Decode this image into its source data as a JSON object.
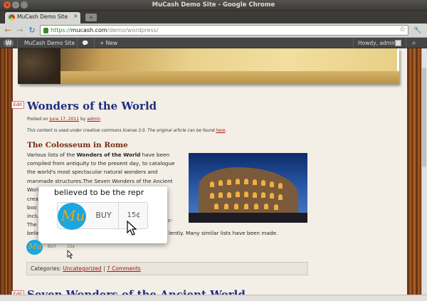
{
  "window": {
    "title": "MuCash Demo Site - Google Chrome",
    "close": "×",
    "minimize": "–",
    "maximize": "□"
  },
  "tab": {
    "label": "MuCash Demo Site",
    "close": "×",
    "new_tab": "+"
  },
  "toolbar": {
    "back": "←",
    "forward": "→",
    "reload": "↻",
    "url_scheme": "https://",
    "url_host": "mucash.com",
    "url_path": "/demo/wordpress/",
    "star": "☆",
    "wrench": "🔧"
  },
  "adminbar": {
    "wp_logo": "W",
    "site_name": "MuCash Demo Site",
    "comments_icon": "💬",
    "new_label": "+ New",
    "greeting": "Howdy, admin",
    "search_icon": "⌕"
  },
  "post": {
    "edit_label": "Edit",
    "title": "Wonders of the World",
    "meta_prefix": "Posted on",
    "date": "June 17, 2011",
    "meta_by": "by",
    "author": "admin",
    "license_text": "This content is used under creative commons license 3.0.  The original article can be found",
    "license_link": "here",
    "license_end": ".",
    "subtitle": "The Colosseum in Rome",
    "body_lines": [
      "Various lists of the Wonders of the World have been",
      "compiled from antiquity to the present day, to catalogue",
      "the world's most spectacular natural wonders and",
      "manmade structures.The Seven Wonders of the Ancient",
      "World is the",
      "crea",
      "boo",
      "inclu",
      "The",
      "belie"
    ],
    "bold_phrase": "Wonders of the World",
    "body_tail": "lently. Many similar lists have been made.",
    "fragment_c": "c-"
  },
  "popup": {
    "text": "believed to be the repr",
    "logo": "Mu",
    "buy": "BUY",
    "price": "15¢"
  },
  "small_widget": {
    "logo": "Mu",
    "buy": "BUY",
    "price": "15¢"
  },
  "categories": {
    "label": "Categories:",
    "category": "Uncategorized",
    "separator": "|",
    "comments": "7 Comments"
  },
  "next_post": {
    "edit_label": "Edit",
    "title": "Seven Wonders of the Ancient World"
  }
}
